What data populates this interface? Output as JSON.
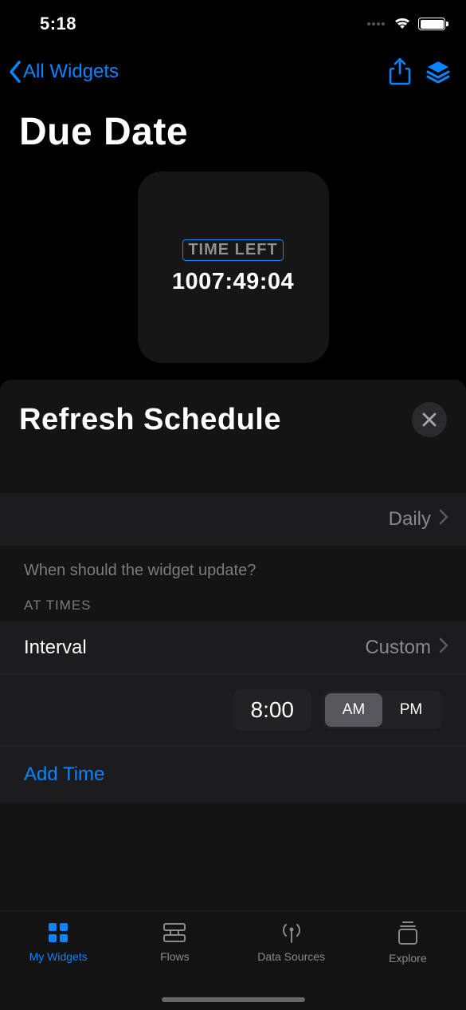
{
  "status": {
    "time": "5:18"
  },
  "nav": {
    "back_label": "All Widgets"
  },
  "page": {
    "title": "Due Date"
  },
  "widget_preview": {
    "badge_label": "TIME LEFT",
    "countdown_value": "1007:49:04"
  },
  "sheet": {
    "title": "Refresh Schedule",
    "frequency_value": "Daily",
    "caption": "When should the widget update?",
    "at_times_header": "AT TIMES",
    "interval_label": "Interval",
    "interval_value": "Custom",
    "time_value": "8:00",
    "am_label": "AM",
    "pm_label": "PM",
    "add_time_label": "Add Time"
  },
  "tabs": {
    "my_widgets": "My Widgets",
    "flows": "Flows",
    "data_sources": "Data Sources",
    "explore": "Explore"
  }
}
